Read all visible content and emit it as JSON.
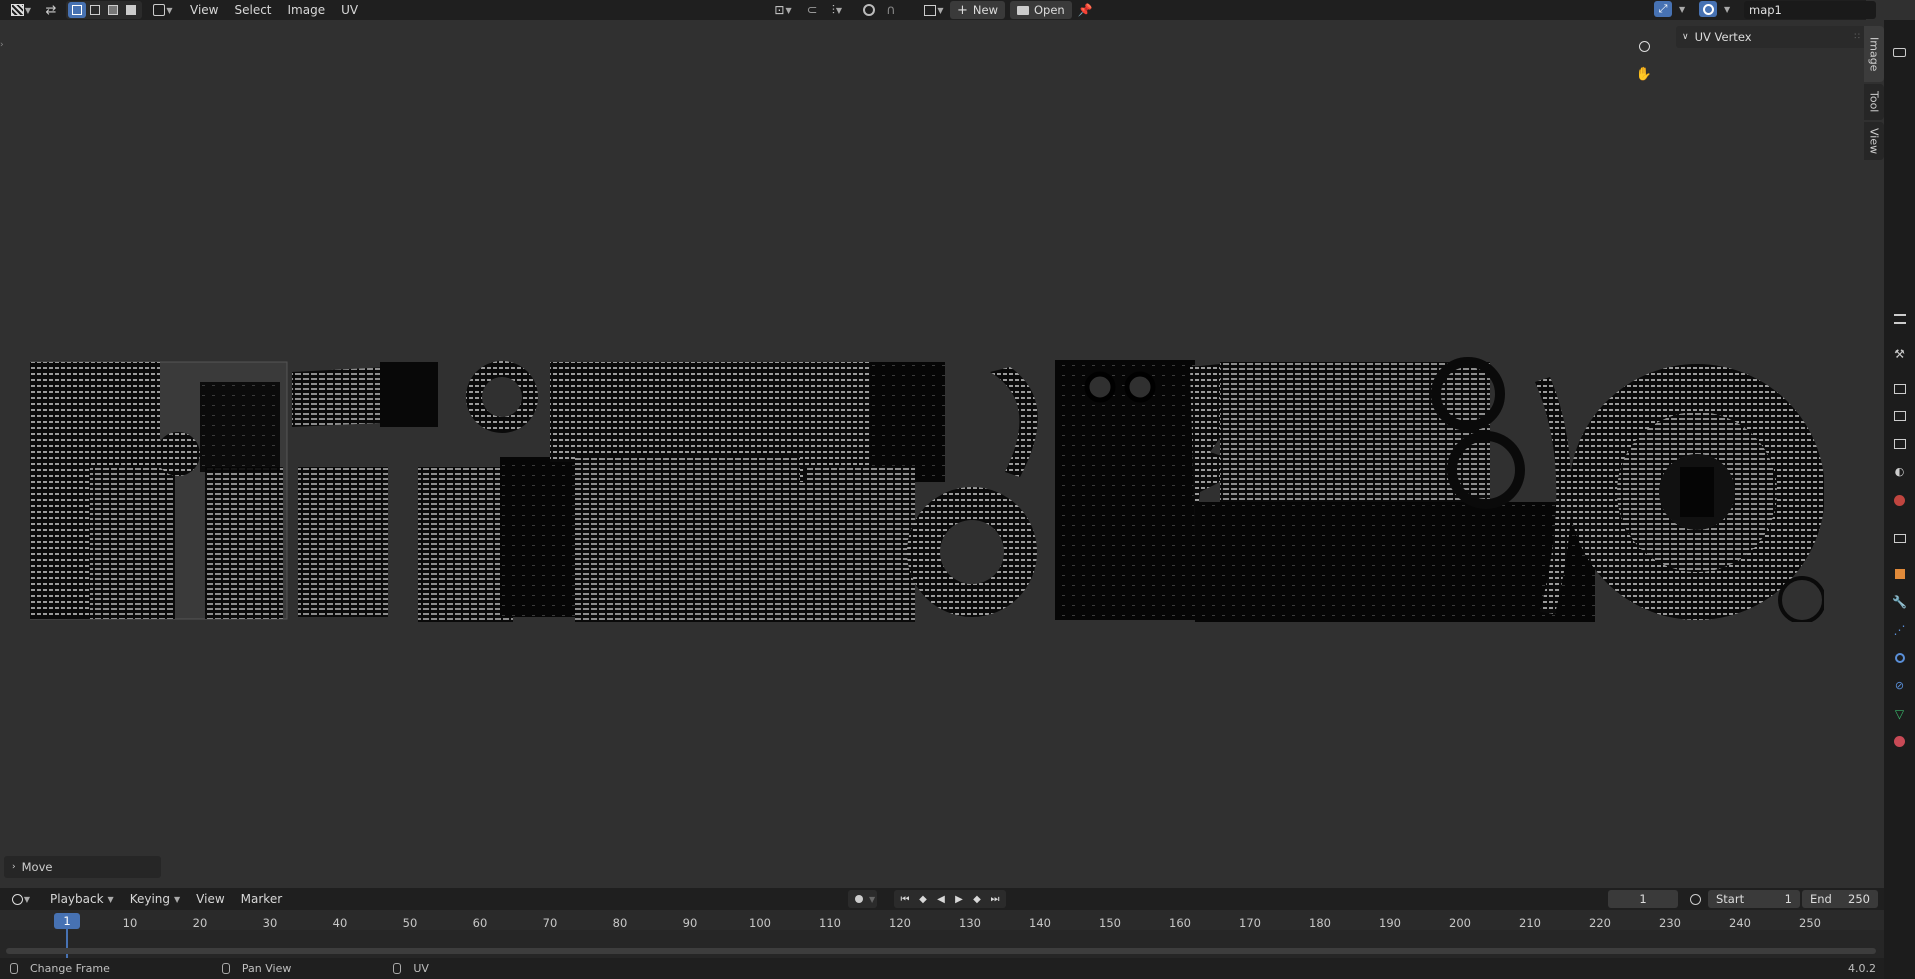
{
  "header": {
    "menus": [
      "View",
      "Select",
      "Image",
      "UV"
    ],
    "new_label": "New",
    "open_label": "Open",
    "image_name": "map1"
  },
  "sidebar": {
    "panel_title": "UV Vertex",
    "tabs": [
      "Image",
      "Tool",
      "View"
    ]
  },
  "operator_panel": {
    "label": "Move"
  },
  "timeline": {
    "menus": [
      "Playback",
      "Keying",
      "View",
      "Marker"
    ],
    "current_frame": "1",
    "start_label": "Start",
    "start_value": "1",
    "end_label": "End",
    "end_value": "250",
    "ticks": [
      "10",
      "20",
      "30",
      "40",
      "50",
      "60",
      "70",
      "80",
      "90",
      "100",
      "110",
      "120",
      "130",
      "140",
      "150",
      "160",
      "170",
      "180",
      "190",
      "200",
      "210",
      "220",
      "230",
      "240",
      "250"
    ],
    "playhead": "1"
  },
  "statusbar": {
    "hints": [
      "Change Frame",
      "Pan View",
      "UV"
    ],
    "version": "4.0.2"
  },
  "colors": {
    "accent": "#4772b3",
    "background": "#303030",
    "header": "#1f1f1f"
  },
  "icons": [
    "uv-editor-icon",
    "sync-selection-icon",
    "vertex-select-icon",
    "edge-select-icon",
    "face-select-icon",
    "island-select-icon",
    "pivot-icon",
    "snap-icon",
    "proportional-icon",
    "image-icon",
    "pin-icon",
    "zoom-icon",
    "hand-icon",
    "camera-icon",
    "gizmo-icon",
    "overlay-icon"
  ]
}
